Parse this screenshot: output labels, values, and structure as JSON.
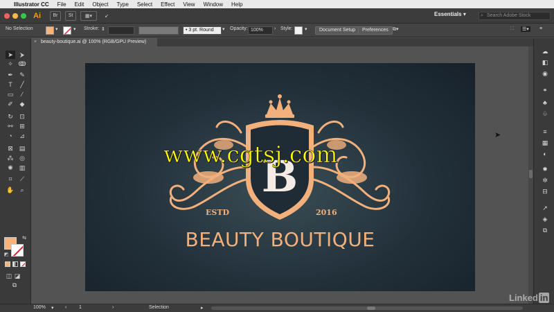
{
  "menubar": {
    "app_name": "Illustrator CC",
    "items": [
      "File",
      "Edit",
      "Object",
      "Type",
      "Select",
      "Effect",
      "View",
      "Window",
      "Help"
    ]
  },
  "appbar": {
    "logo": "Ai",
    "bridge_label": "Br",
    "stock_label": "St",
    "workspace": "Essentials",
    "search_placeholder": "Search Adobe Stock"
  },
  "control": {
    "selection_label": "No Selection",
    "stroke_label": "Stroke:",
    "brush_value": "3 pt. Round",
    "opacity_label": "Opacity:",
    "opacity_value": "100%",
    "style_label": "Style:",
    "document_setup": "Document Setup",
    "preferences": "Preferences"
  },
  "document": {
    "tab_title": "beauty-boutique.ai @ 100% (RGB/GPU Preview)"
  },
  "artwork": {
    "monogram": "B",
    "estd": "ESTD",
    "year": "2016",
    "brand_name": "BEAUTY BOUTIQUE",
    "watermark": "www.cgtsj.com"
  },
  "status": {
    "zoom": "100%",
    "artboard_number": "1",
    "tool_name": "Selection"
  },
  "branding": {
    "linkedin_prefix": "Linked",
    "linkedin_suffix": "in"
  },
  "colors": {
    "fill": "#f7b37c",
    "accent_gold": "#f2b07c",
    "watermark": "#ffff00",
    "artboard_bg": "#22303a"
  }
}
